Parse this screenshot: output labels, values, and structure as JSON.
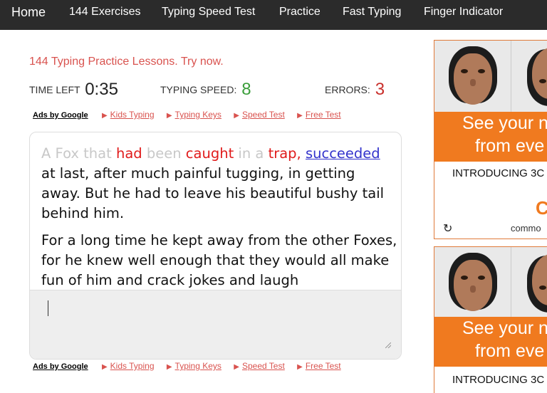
{
  "nav": {
    "home": "Home",
    "exercises": "144 Exercises",
    "speed_test": "Typing Speed Test",
    "practice": "Practice",
    "fast_typing": "Fast Typing",
    "finger_indicator": "Finger Indicator"
  },
  "promo": "144 Typing Practice Lessons. Try now.",
  "stats": {
    "time_label": "Time left",
    "time_value": "0:35",
    "speed_label": "Typing speed:",
    "speed_value": "8",
    "errors_label": "Errors:",
    "errors_value": "3"
  },
  "ads_row": {
    "ads_by_google": "Ads by Google",
    "links": [
      "Kids Typing",
      "Typing Keys",
      "Speed Test",
      "Free Test"
    ]
  },
  "passage": {
    "typed_words": [
      {
        "text": "A",
        "state": "done"
      },
      {
        "text": "Fox",
        "state": "done"
      },
      {
        "text": "that",
        "state": "done"
      },
      {
        "text": "had",
        "state": "error"
      },
      {
        "text": "been",
        "state": "done"
      },
      {
        "text": "caught",
        "state": "error"
      },
      {
        "text": "in",
        "state": "done"
      },
      {
        "text": "a",
        "state": "done"
      },
      {
        "text": "trap,",
        "state": "error"
      }
    ],
    "current_word": "succeeded",
    "remaining_1": " at last, after much painful tugging, in getting away. But he had to leave his beautiful bushy tail behind him.",
    "paragraph_2": "For a long time he kept away from the other Foxes, for he knew well enough that they would all make fun of him and crack jokes and laugh"
  },
  "input": {
    "value": ""
  },
  "ads": [
    {
      "headline_1": "See your n",
      "headline_2": "from eve",
      "intro": "INTRODUCING 3C",
      "mark": "C",
      "refresh_icon": "refresh-icon",
      "brand": "commo"
    },
    {
      "headline_1": "See your n",
      "headline_2": "from eve",
      "intro": "INTRODUCING 3C"
    }
  ],
  "colors": {
    "nav_bg": "#2b2b2b",
    "accent_red": "#d9534f",
    "speed_green": "#3a9e3a",
    "error_red": "#c9302c",
    "ad_orange": "#f07a1f"
  }
}
